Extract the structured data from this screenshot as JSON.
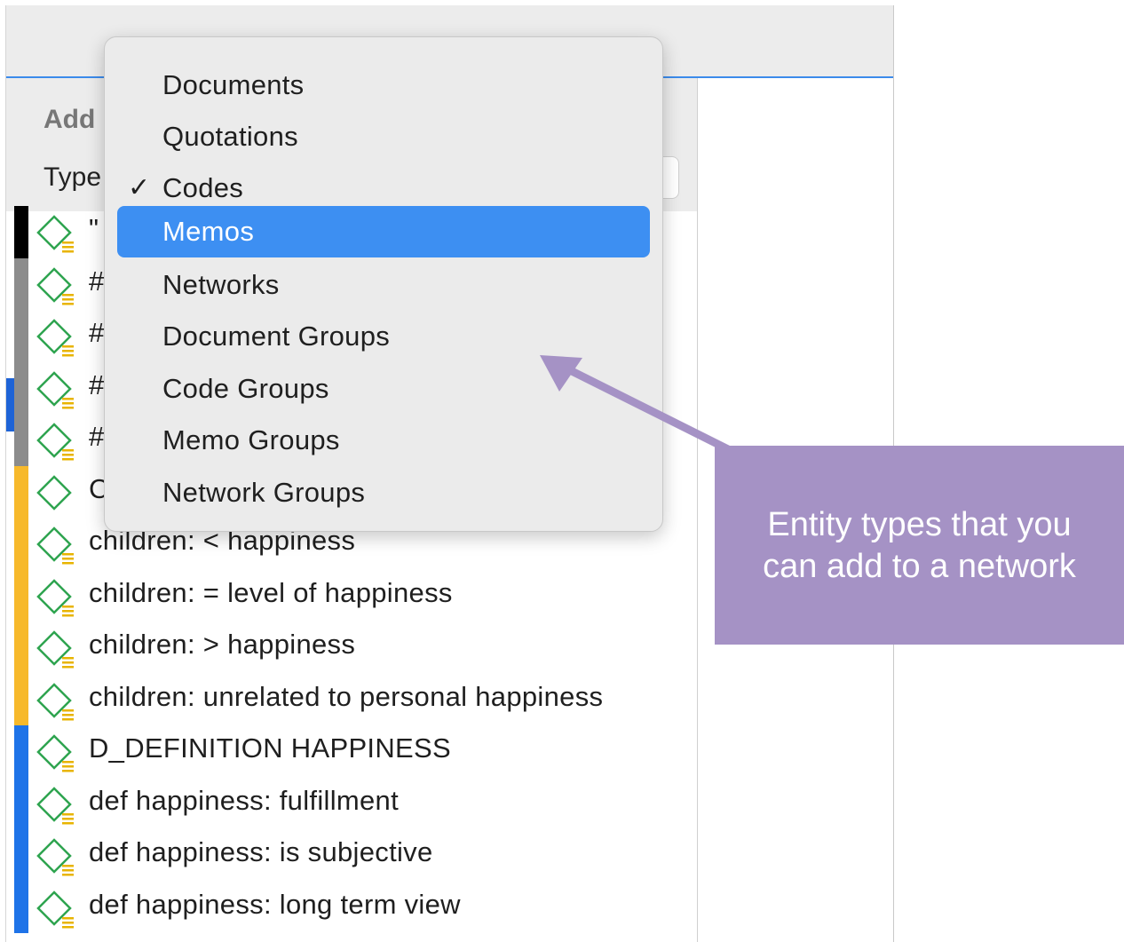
{
  "panel": {
    "title": "Add",
    "type_label": "Type"
  },
  "menu": {
    "items": [
      {
        "label": "Documents",
        "checked": false,
        "highlighted": false
      },
      {
        "label": "Quotations",
        "checked": false,
        "highlighted": false
      },
      {
        "label": "Codes",
        "checked": true,
        "highlighted": false
      },
      {
        "label": "Memos",
        "checked": false,
        "highlighted": true
      },
      {
        "label": "Networks",
        "checked": false,
        "highlighted": false
      },
      {
        "label": "Document Groups",
        "checked": false,
        "highlighted": false
      },
      {
        "label": "Code Groups",
        "checked": false,
        "highlighted": false
      },
      {
        "label": "Memo Groups",
        "checked": false,
        "highlighted": false
      },
      {
        "label": "Network Groups",
        "checked": false,
        "highlighted": false
      }
    ],
    "check_glyph": "✓"
  },
  "list": {
    "rows": [
      {
        "label": "\"",
        "color": "#000000"
      },
      {
        "label": "#",
        "color": "#8c8c8c"
      },
      {
        "label": "#",
        "color": "#8c8c8c"
      },
      {
        "label": "#",
        "color": "#8c8c8c"
      },
      {
        "label": "#",
        "color": "#8c8c8c"
      },
      {
        "label": "C",
        "color": "#f7b92b"
      },
      {
        "label": "children: < happiness",
        "color": "#f7b92b"
      },
      {
        "label": "children: = level of happiness",
        "color": "#f7b92b"
      },
      {
        "label": "children: > happiness",
        "color": "#f7b92b"
      },
      {
        "label": "children: unrelated to personal happiness",
        "color": "#f7b92b"
      },
      {
        "label": "D_DEFINITION HAPPINESS",
        "color": "#1e73e8"
      },
      {
        "label": "def happiness: fulfillment",
        "color": "#1e73e8"
      },
      {
        "label": "def happiness: is subjective",
        "color": "#1e73e8"
      },
      {
        "label": "def happiness: long term view",
        "color": "#1e73e8"
      }
    ],
    "icon": "code-diamond-icon"
  },
  "callout": {
    "line1": "Entity types that you",
    "line2": "can add to a network"
  },
  "colors": {
    "accent": "#3d8ff2",
    "callout_bg": "#a592c5",
    "icon_green": "#2ea44f",
    "memo_yellow": "#e8b400"
  }
}
